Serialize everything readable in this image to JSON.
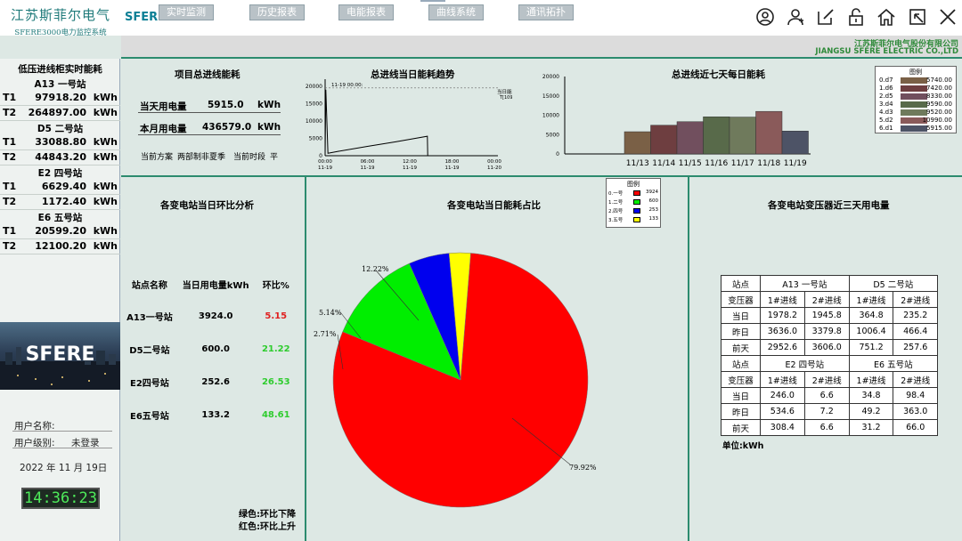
{
  "header": {
    "company_cn": "江苏斯菲尔电气",
    "system_name": "SFERE3000电力监控系统",
    "brand": "SFERE",
    "icons": [
      "user-circle-icon",
      "users-icon",
      "edit-icon",
      "unlock-icon",
      "home-icon",
      "shrink-icon",
      "close-icon"
    ]
  },
  "tabs": [
    "实时监测",
    "历史报表",
    "电能报表",
    "曲线系统",
    "通讯拓扑"
  ],
  "company": {
    "cn": "江苏斯菲尔电气股份有限公司",
    "en": "JIANGSU SFERE ELECTRIC CO.,LTD"
  },
  "left": {
    "title": "低压进线柜实时能耗",
    "stations": [
      {
        "name": "A13 一号站",
        "rows": [
          {
            "k": "T1",
            "v": "97918.20",
            "u": "kWh"
          },
          {
            "k": "T2",
            "v": "264897.00",
            "u": "kWh"
          }
        ]
      },
      {
        "name": "D5 二号站",
        "rows": [
          {
            "k": "T1",
            "v": "33088.80",
            "u": "kWh"
          },
          {
            "k": "T2",
            "v": "44843.20",
            "u": "kWh"
          }
        ]
      },
      {
        "name": "E2 四号站",
        "rows": [
          {
            "k": "T1",
            "v": "6629.40",
            "u": "kWh"
          },
          {
            "k": "T2",
            "v": "1172.40",
            "u": "kWh"
          }
        ]
      },
      {
        "name": "E6 五号站",
        "rows": [
          {
            "k": "T1",
            "v": "20599.20",
            "u": "kWh"
          },
          {
            "k": "T2",
            "v": "12100.20",
            "u": "kWh"
          }
        ]
      }
    ],
    "photo_label": "SFERE",
    "user_name_label": "用户名称:",
    "user_level_label": "用户级别:",
    "user_level_value": "未登录",
    "date": "2022 年 11 月 19日",
    "time": "14:36:23"
  },
  "total": {
    "title": "项目总进线能耗",
    "today_label": "当天用电量",
    "today_value": "5915.0",
    "today_unit": "kWh",
    "month_label": "本月用电量",
    "month_value": "436579.0",
    "month_unit": "kWh",
    "scheme_label": "当前方案",
    "scheme_value": "两部制非夏季",
    "period_label": "当前时段",
    "period_value": "平"
  },
  "trend": {
    "title": "总进线当日能耗趋势",
    "cursor_label": "11-19 00:00:",
    "legend_name": "当日能耗",
    "legend_value": "T[10990]"
  },
  "week": {
    "title": "总进线近七天每日能耗"
  },
  "ratio": {
    "title": "各变电站当日环比分析",
    "headers": [
      "站点名称",
      "当日用电量kWh",
      "环比%"
    ],
    "rows": [
      {
        "name": "A13一号站",
        "value": "3924.0",
        "ratio": "5.15",
        "color": "#e02020"
      },
      {
        "name": "D5二号站",
        "value": "600.0",
        "ratio": "21.22",
        "color": "#2ecc2e"
      },
      {
        "name": "E2四号站",
        "value": "252.6",
        "ratio": "26.53",
        "color": "#2ecc2e"
      },
      {
        "name": "E6五号站",
        "value": "133.2",
        "ratio": "48.61",
        "color": "#2ecc2e"
      }
    ],
    "note_green": "绿色:环比下降",
    "note_red": "红色:环比上升"
  },
  "pie": {
    "title": "各变电站当日能耗占比",
    "legend_title": "图例",
    "pct_labels": [
      "79.92%",
      "12.22%",
      "5.14%",
      "2.71%"
    ]
  },
  "transformer": {
    "title": "各变电站变压器近三天用电量",
    "unit": "单位:kWh",
    "rows": [
      [
        "站点",
        "A13 一号站",
        "",
        "D5 二号站",
        ""
      ],
      [
        "变压器",
        "1#进线",
        "2#进线",
        "1#进线",
        "2#进线"
      ],
      [
        "当日",
        "1978.2",
        "1945.8",
        "364.8",
        "235.2"
      ],
      [
        "昨日",
        "3636.0",
        "3379.8",
        "1006.4",
        "466.4"
      ],
      [
        "前天",
        "2952.6",
        "3606.0",
        "751.2",
        "257.6"
      ],
      [
        "站点",
        "E2 四号站",
        "",
        "E6 五号站",
        ""
      ],
      [
        "变压器",
        "1#进线",
        "2#进线",
        "1#进线",
        "2#进线"
      ],
      [
        "当日",
        "246.0",
        "6.6",
        "34.8",
        "98.4"
      ],
      [
        "昨日",
        "534.6",
        "7.2",
        "49.2",
        "363.0"
      ],
      [
        "前天",
        "308.4",
        "6.6",
        "31.2",
        "66.0"
      ]
    ]
  },
  "chart_data": [
    {
      "type": "line",
      "title": "总进线当日能耗趋势",
      "x_ticks": [
        "00:00\n11-19",
        "06:00\n11-19",
        "12:00\n11-19",
        "18:00\n11-19",
        "00:00\n11-20"
      ],
      "y_ticks": [
        0,
        5000,
        10000,
        15000,
        20000
      ],
      "ylim": [
        0,
        21000
      ],
      "series": [
        {
          "name": "当日能耗",
          "x_hours": [
            0,
            0.1,
            0.4,
            2,
            6,
            10,
            14.5,
            14.55,
            14.6
          ],
          "values": [
            0,
            19000,
            700,
            1300,
            2700,
            4000,
            5600,
            0,
            0
          ]
        }
      ]
    },
    {
      "type": "bar",
      "title": "总进线近七天每日能耗",
      "categories": [
        "11/13",
        "11/14",
        "11/15",
        "11/16",
        "11/17",
        "11/18",
        "11/19"
      ],
      "values": [
        5740,
        7420,
        8330,
        9590,
        9520,
        10990,
        5915
      ],
      "colors": [
        "#7a6046",
        "#6e3e40",
        "#714f5e",
        "#586a4a",
        "#6f7a5c",
        "#8a5a5a",
        "#4d5366"
      ],
      "y_ticks": [
        0,
        5000,
        10000,
        15000,
        20000
      ],
      "ylim": [
        0,
        20000
      ],
      "legend": {
        "title": "图例",
        "entries": [
          "0.d7",
          "1.d6",
          "2.d5",
          "3.d4",
          "4.d3",
          "5.d2",
          "6.d1"
        ],
        "values": [
          "5740.00",
          "7420.00",
          "8330.00",
          "9590.00",
          "9520.00",
          "10990.00",
          "5915.00"
        ]
      }
    },
    {
      "type": "pie",
      "title": "各变电站当日能耗占比",
      "labels": [
        "0.一号",
        "1.二号",
        "2.四号",
        "3.五号"
      ],
      "values": [
        3924,
        600,
        253,
        133
      ],
      "colors": [
        "#ff0000",
        "#00ee00",
        "#0000ee",
        "#ffff00"
      ]
    }
  ]
}
